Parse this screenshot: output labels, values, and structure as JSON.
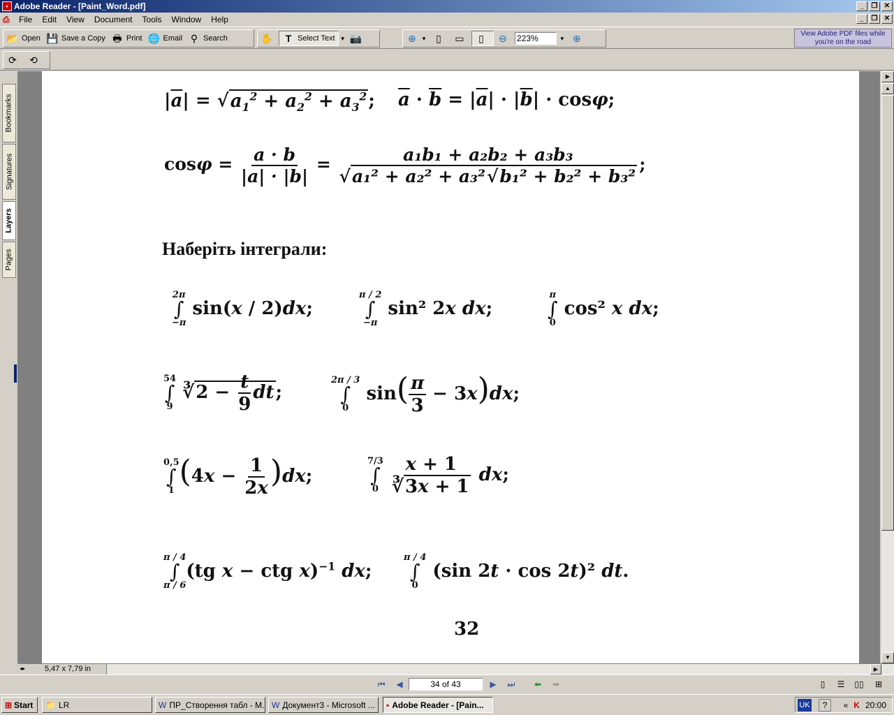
{
  "window": {
    "title": "Adobe Reader - [Paint_Word.pdf]",
    "app_icon": "pdf-icon"
  },
  "menu": {
    "items": [
      "File",
      "Edit",
      "View",
      "Document",
      "Tools",
      "Window",
      "Help"
    ]
  },
  "toolbar": {
    "open": "Open",
    "save_copy": "Save a Copy",
    "print": "Print",
    "email": "Email",
    "search": "Search",
    "select_text": "Select Text",
    "zoom": "223%"
  },
  "ad": {
    "line1": "View Adobe PDF files while",
    "line2": "you're on the road"
  },
  "side_tabs": [
    "Bookmarks",
    "Signatures",
    "Layers",
    "Pages"
  ],
  "document": {
    "heading": "Наберіть інтеграли:",
    "page_number": "32"
  },
  "status": {
    "page_size": "5,47 x 7,79 in",
    "page_field": "34 of 43"
  },
  "taskbar": {
    "start": "Start",
    "tasks": [
      "LR",
      "ПР_Створення табл - M...",
      "Документ3 - Microsoft ...",
      "Adobe Reader - [Pain..."
    ],
    "lang": "UK",
    "help": "?",
    "time": "20:00"
  }
}
